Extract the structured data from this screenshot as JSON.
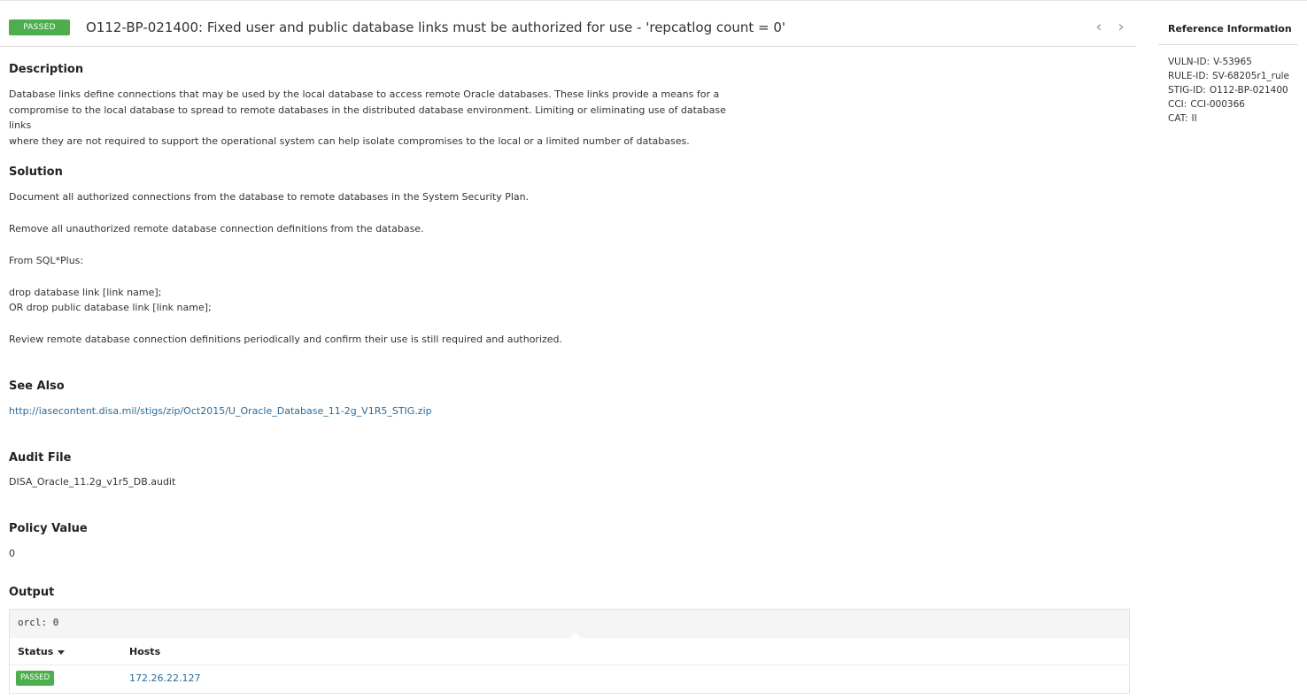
{
  "header": {
    "status_badge": "PASSED",
    "title": "O112-BP-021400: Fixed user and public database links must be authorized for use - 'repcatlog count = 0'",
    "prev_icon": "chevron-left-icon",
    "next_icon": "chevron-right-icon"
  },
  "description": {
    "heading": "Description",
    "lines": [
      "Database links define connections that may be used by the local database to access remote Oracle databases. These links provide a means for a",
      "compromise to the local database to spread to remote databases in the distributed database environment. Limiting or eliminating use of database links",
      "where they are not required to support the operational system can help isolate compromises to the local or a limited number of databases."
    ]
  },
  "solution": {
    "heading": "Solution",
    "line1": "Document all authorized connections from the database to remote databases in the System Security Plan.",
    "line2": "Remove all unauthorized remote database connection definitions from the database.",
    "line3": "From SQL*Plus:",
    "line4": "drop database link [link name];",
    "line5": "OR drop public database link [link name];",
    "line6": "Review remote database connection definitions periodically and confirm their use is still required and authorized."
  },
  "see_also": {
    "heading": "See Also",
    "link": "http://iasecontent.disa.mil/stigs/zip/Oct2015/U_Oracle_Database_11-2g_V1R5_STIG.zip"
  },
  "audit_file": {
    "heading": "Audit File",
    "value": "DISA_Oracle_11.2g_v1r5_DB.audit"
  },
  "policy_value": {
    "heading": "Policy Value",
    "value": "0"
  },
  "output": {
    "heading": "Output",
    "code": "orcl: 0",
    "columns": {
      "status": "Status",
      "hosts": "Hosts"
    },
    "rows": [
      {
        "status": "PASSED",
        "host": "172.26.22.127"
      }
    ]
  },
  "reference": {
    "heading": "Reference Information",
    "items": [
      {
        "key": "VULN-ID:",
        "value": "V-53965"
      },
      {
        "key": "RULE-ID:",
        "value": "SV-68205r1_rule"
      },
      {
        "key": "STIG-ID:",
        "value": "O112-BP-021400"
      },
      {
        "key": "CCI:",
        "value": "CCI-000366"
      },
      {
        "key": "CAT:",
        "value": "II"
      }
    ]
  },
  "colors": {
    "passed": "#4cae4c",
    "link": "#2a6b9c"
  }
}
